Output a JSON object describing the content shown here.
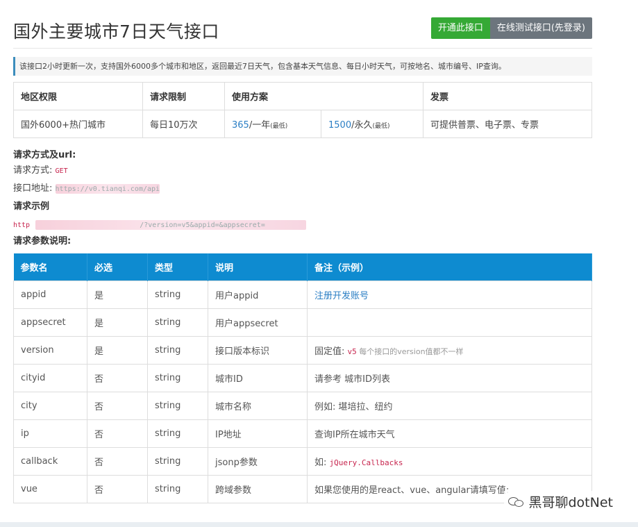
{
  "header": {
    "title": "国外主要城市7日天气接口",
    "btn_open": "开通此接口",
    "btn_test": "在线测试接口(先登录)"
  },
  "notice": "该接口2小时更新一次，支持国外6000多个城市和地区，返回最近7日天气，包含基本天气信息、每日小时天气，可按地名、城市编号、IP查询。",
  "info_table": {
    "headers": [
      "地区权限",
      "请求限制",
      "使用方案",
      "发票"
    ],
    "region": "国外6000+热门城市",
    "limit": "每日10万次",
    "plan1_price": "365",
    "plan1_unit": "/一年",
    "plan1_note": "(最低)",
    "plan2_price": "1500",
    "plan2_unit": "/永久",
    "plan2_note": "(最低)",
    "invoice": "可提供普票、电子票、专票"
  },
  "request": {
    "section_title": "请求方式及url:",
    "method_label": "请求方式:",
    "method_value": "GET",
    "url_label": "接口地址:",
    "url_value": "https://v0.tianqi.com/api",
    "example_title": "请求示例",
    "example_prefix": "http",
    "example_blurred": "/?version=v5&appid=&appsecret="
  },
  "params": {
    "section_title": "请求参数说明:",
    "headers": [
      "参数名",
      "必选",
      "类型",
      "说明",
      "备注（示例）"
    ],
    "rows": [
      {
        "name": "appid",
        "required": "是",
        "type": "string",
        "desc": "用户appid",
        "note": "注册开发账号"
      },
      {
        "name": "appsecret",
        "required": "是",
        "type": "string",
        "desc": "用户appsecret",
        "note": ""
      },
      {
        "name": "version",
        "required": "是",
        "type": "string",
        "desc": "接口版本标识",
        "note_prefix": "固定值: ",
        "note_code": "v5",
        "note_suffix": " 每个接口的version值都不一样"
      },
      {
        "name": "cityid",
        "required": "否",
        "type": "string",
        "desc": "城市ID",
        "note": "请参考 城市ID列表"
      },
      {
        "name": "city",
        "required": "否",
        "type": "string",
        "desc": "城市名称",
        "note": "例如: 堪培拉、纽约"
      },
      {
        "name": "ip",
        "required": "否",
        "type": "string",
        "desc": "IP地址",
        "note": "查询IP所在城市天气"
      },
      {
        "name": "callback",
        "required": "否",
        "type": "string",
        "desc": "jsonp参数",
        "note_prefix": "如: ",
        "note_code": "jQuery.Callbacks"
      },
      {
        "name": "vue",
        "required": "否",
        "type": "string",
        "desc": "跨域参数",
        "note": "如果您使用的是react、vue、angular请填写值:"
      }
    ]
  },
  "watermark": "黑哥聊dotNet",
  "colors": {
    "green": "#35a935",
    "gray": "#6c757d",
    "table_header": "#0e8bd0",
    "link": "#2a7ec4",
    "code": "#c7254e"
  }
}
